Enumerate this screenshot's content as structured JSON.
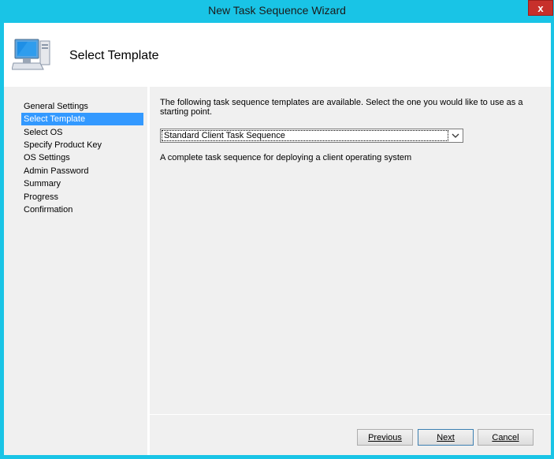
{
  "window": {
    "title": "New Task Sequence Wizard",
    "close_label": "x"
  },
  "header": {
    "title": "Select Template",
    "icon": "computer-icon"
  },
  "nav": {
    "items": [
      {
        "label": "General Settings",
        "selected": false
      },
      {
        "label": "Select Template",
        "selected": true
      },
      {
        "label": "Select OS",
        "selected": false
      },
      {
        "label": "Specify Product Key",
        "selected": false
      },
      {
        "label": "OS Settings",
        "selected": false
      },
      {
        "label": "Admin Password",
        "selected": false
      },
      {
        "label": "Summary",
        "selected": false
      },
      {
        "label": "Progress",
        "selected": false
      },
      {
        "label": "Confirmation",
        "selected": false
      }
    ]
  },
  "content": {
    "description": "The following task sequence templates are available.  Select the one you would like to use as a starting point.",
    "template_select": {
      "value": "Standard Client Task Sequence"
    },
    "template_description": "A complete task sequence for deploying a client operating system"
  },
  "buttons": {
    "previous": "Previous",
    "next": "Next",
    "cancel": "Cancel"
  },
  "colors": {
    "titlebar": "#19c4e6",
    "selection": "#3399ff",
    "close": "#c7302b"
  }
}
